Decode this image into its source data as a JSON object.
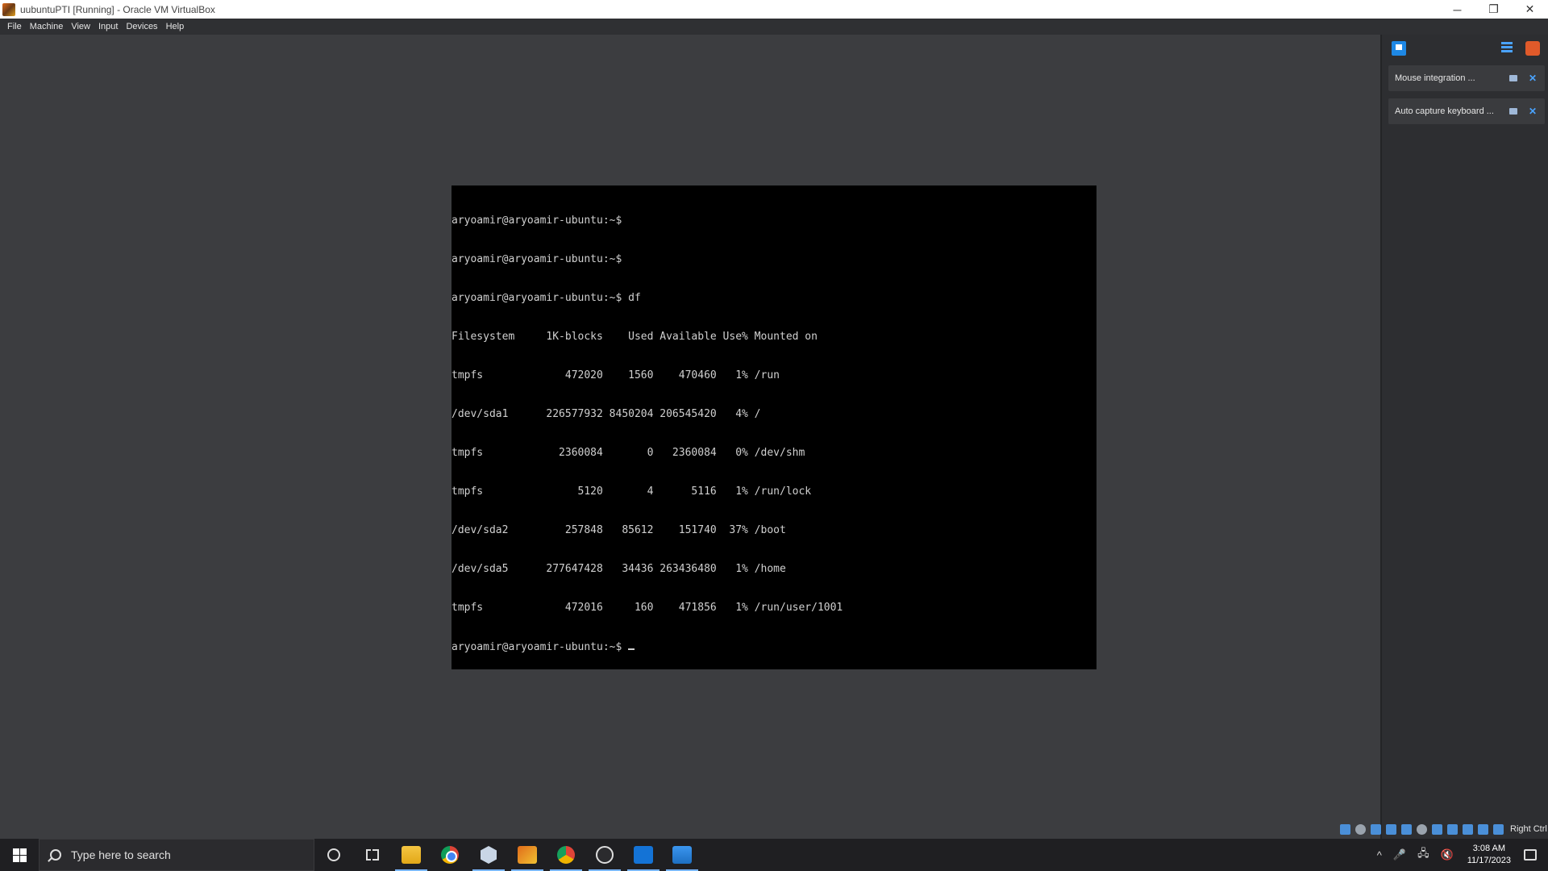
{
  "window": {
    "title": "uubuntuPTI [Running] - Oracle VM VirtualBox",
    "controls": {
      "minimize": "─",
      "restore": "❐",
      "close": "✕"
    }
  },
  "menu": {
    "items": [
      "File",
      "Machine",
      "View",
      "Input",
      "Devices",
      "Help"
    ]
  },
  "terminal": {
    "lines": [
      "aryoamir@aryoamir-ubuntu:~$",
      "aryoamir@aryoamir-ubuntu:~$",
      "aryoamir@aryoamir-ubuntu:~$ df",
      "Filesystem     1K-blocks    Used Available Use% Mounted on",
      "tmpfs             472020    1560    470460   1% /run",
      "/dev/sda1      226577932 8450204 206545420   4% /",
      "tmpfs            2360084       0   2360084   0% /dev/shm",
      "tmpfs               5120       4      5116   1% /run/lock",
      "/dev/sda2         257848   85612    151740  37% /boot",
      "/dev/sda5      277647428   34436 263436480   1% /home",
      "tmpfs             472016     160    471856   1% /run/user/1001",
      "aryoamir@aryoamir-ubuntu:~$ "
    ]
  },
  "notifications": {
    "items": [
      {
        "text": "Mouse integration ...",
        "close": "✕"
      },
      {
        "text": "Auto capture keyboard ...",
        "close": "✕"
      }
    ]
  },
  "status": {
    "host_key": "Right Ctrl"
  },
  "taskbar": {
    "search_placeholder": "Type here to search",
    "time": "3:08 AM",
    "date": "11/17/2023",
    "tray_chevron": "^",
    "tray_mic": "🎤",
    "tray_network": "🖧",
    "tray_volume": "🔇"
  },
  "colors": {
    "vm_background": "#3c3d40",
    "terminal_bg": "#000000",
    "accent": "#4aa3ff"
  }
}
